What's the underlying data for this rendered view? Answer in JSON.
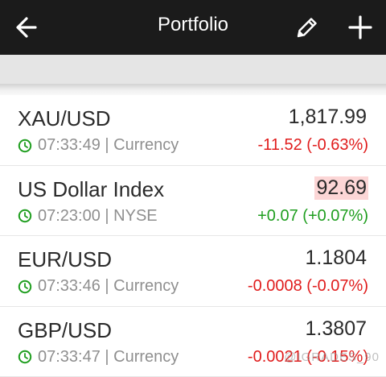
{
  "header": {
    "title": "Portfolio",
    "back_icon": "arrow-left-icon",
    "edit_icon": "pencil-icon",
    "add_icon": "plus-icon"
  },
  "colors": {
    "header_bg": "#1b1b1b",
    "negative": "#e01c1c",
    "positive": "#1f9e1f",
    "clock": "#1f9e1f",
    "highlight": "#fcd6d6"
  },
  "rows": [
    {
      "name": "XAU/USD",
      "time": "07:33:49",
      "exchange": "Currency",
      "meta": "07:33:49 | Currency",
      "price": "1,817.99",
      "change": "-11.52 (-0.63%)",
      "direction": "neg",
      "highlight": false
    },
    {
      "name": "US Dollar Index",
      "time": "07:23:00",
      "exchange": "NYSE",
      "meta": "07:23:00 | NYSE",
      "price": "92.69",
      "change": "+0.07 (+0.07%)",
      "direction": "pos",
      "highlight": true
    },
    {
      "name": "EUR/USD",
      "time": "07:33:46",
      "exchange": "Currency",
      "meta": "07:33:46 | Currency",
      "price": "1.1804",
      "change": "-0.0008 (-0.07%)",
      "direction": "neg",
      "highlight": false
    },
    {
      "name": "GBP/USD",
      "time": "07:33:47",
      "exchange": "Currency",
      "meta": "07:33:47 | Currency",
      "price": "1.3807",
      "change": "-0.0021 (-0.15%)",
      "direction": "neg",
      "highlight": false
    }
  ],
  "watermark": "@IGRADES_90"
}
